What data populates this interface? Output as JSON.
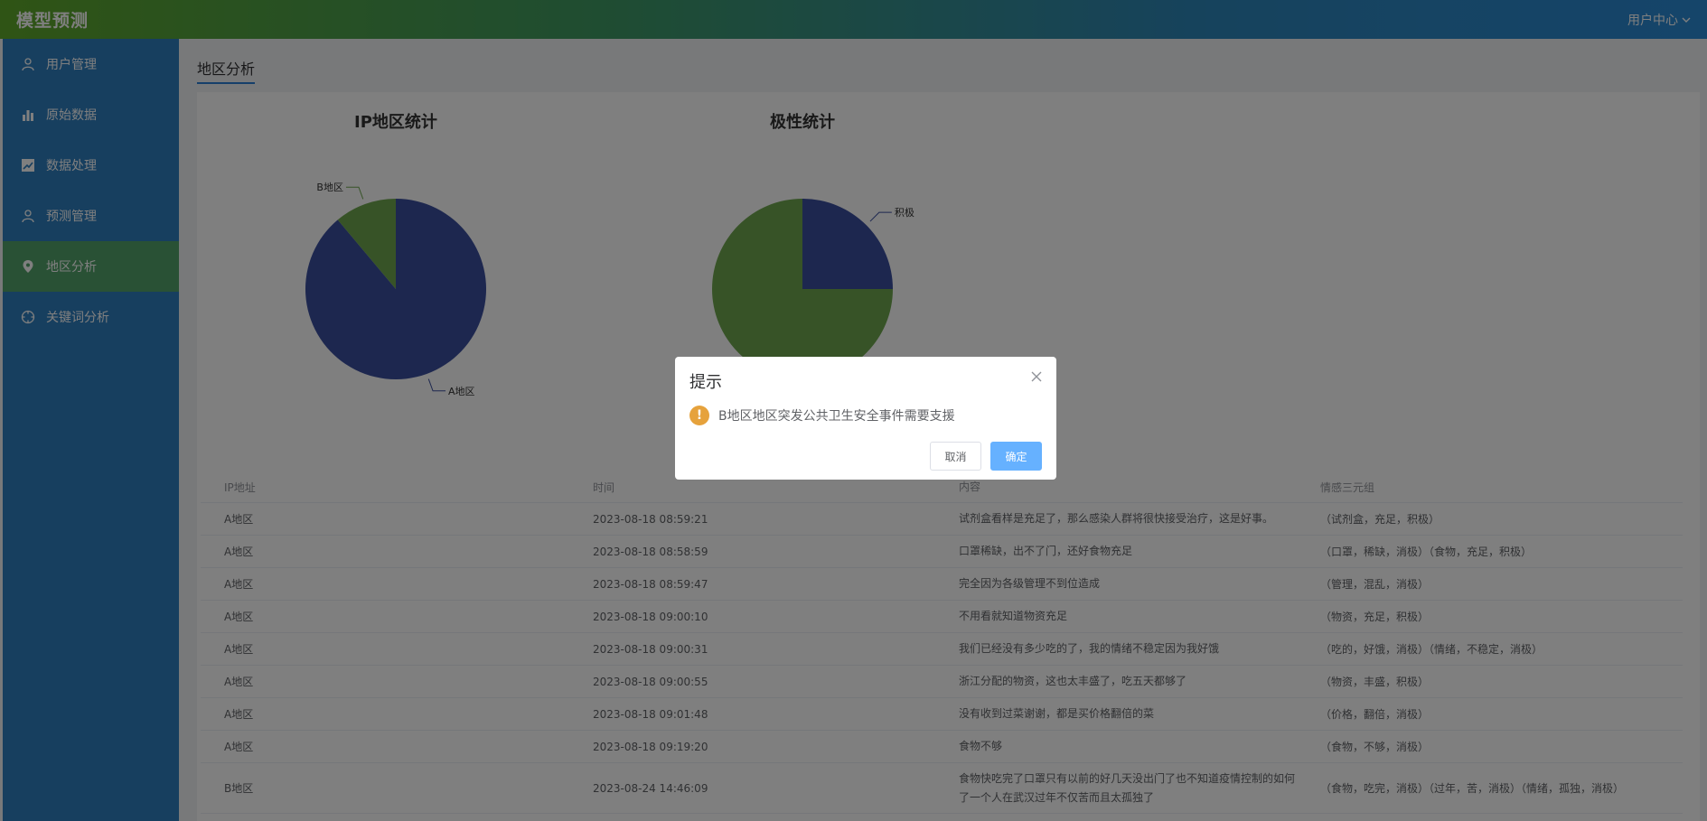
{
  "header": {
    "title": "模型预测",
    "user_menu": "用户中心"
  },
  "sidebar": {
    "items": [
      {
        "label": "用户管理",
        "icon": "user-icon"
      },
      {
        "label": "原始数据",
        "icon": "bar-chart-icon"
      },
      {
        "label": "数据处理",
        "icon": "line-chart-icon"
      },
      {
        "label": "预测管理",
        "icon": "user-icon"
      },
      {
        "label": "地区分析",
        "icon": "location-icon",
        "active": true
      },
      {
        "label": "关键词分析",
        "icon": "compass-icon"
      }
    ]
  },
  "tab": {
    "label": "地区分析"
  },
  "charts": {
    "ip": {
      "title": "IP地区统计"
    },
    "polarity": {
      "title": "极性统计"
    }
  },
  "chart_data": [
    {
      "type": "pie",
      "title": "IP地区统计",
      "slices": [
        {
          "label": "A地区",
          "value": 8,
          "color": "#3b4f9e"
        },
        {
          "label": "B地区",
          "value": 1,
          "color": "#6ea64f"
        }
      ]
    },
    {
      "type": "pie",
      "title": "极性统计",
      "slices": [
        {
          "label": "积极",
          "value": 25,
          "color": "#3b4f9e"
        },
        {
          "label": "",
          "value": 75,
          "color": "#6ea64f"
        }
      ]
    }
  ],
  "table": {
    "headers": [
      "IP地址",
      "时间",
      "内容",
      "情感三元组"
    ],
    "rows": [
      {
        "ip": "A地区",
        "time": "2023-08-18 08:59:21",
        "content": "试剂盒看样是充足了，那么感染人群将很快接受治疗，这是好事。",
        "triples": "（试剂盒，充足，积极）"
      },
      {
        "ip": "A地区",
        "time": "2023-08-18 08:58:59",
        "content": "口罩稀缺，出不了门，还好食物充足",
        "triples": "（口罩，稀缺，消极）（食物，充足，积极）"
      },
      {
        "ip": "A地区",
        "time": "2023-08-18 08:59:47",
        "content": "完全因为各级管理不到位造成",
        "triples": "（管理，混乱，消极）"
      },
      {
        "ip": "A地区",
        "time": "2023-08-18 09:00:10",
        "content": "不用看就知道物资充足",
        "triples": "（物资，充足，积极）"
      },
      {
        "ip": "A地区",
        "time": "2023-08-18 09:00:31",
        "content": "我们已经没有多少吃的了，我的情绪不稳定因为我好饿",
        "triples": "（吃的，好饿，消极）（情绪，不稳定，消极）"
      },
      {
        "ip": "A地区",
        "time": "2023-08-18 09:00:55",
        "content": "浙江分配的物资，这也太丰盛了，吃五天都够了",
        "triples": "（物资，丰盛，积极）"
      },
      {
        "ip": "A地区",
        "time": "2023-08-18 09:01:48",
        "content": "没有收到过菜谢谢，都是买价格翻倍的菜",
        "triples": "（价格，翻倍，消极）"
      },
      {
        "ip": "A地区",
        "time": "2023-08-18 09:19:20",
        "content": "食物不够",
        "triples": "（食物，不够，消极）"
      },
      {
        "ip": "B地区",
        "time": "2023-08-24 14:46:09",
        "content": "食物快吃完了口罩只有以前的好几天没出门了也不知道疫情控制的如何了一个人在武汉过年不仅苦而且太孤独了",
        "triples": "（食物，吃完，消极）（过年，苦，消极）（情绪，孤独，消极）"
      }
    ]
  },
  "dialog": {
    "title": "提示",
    "message": "B地区地区突发公共卫生安全事件需要支援",
    "cancel_label": "取消",
    "confirm_label": "确定"
  }
}
